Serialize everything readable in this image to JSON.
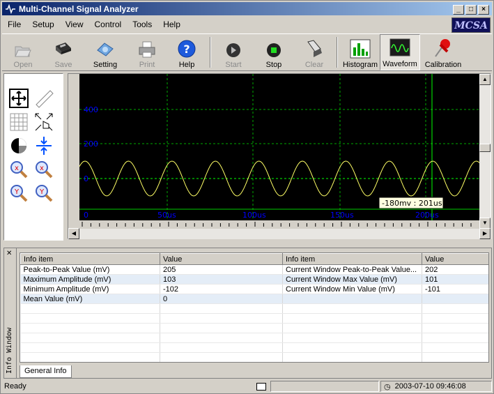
{
  "window": {
    "title": "Multi-Channel Signal Analyzer",
    "logo": "MCSA"
  },
  "menu": [
    "File",
    "Setup",
    "View",
    "Control",
    "Tools",
    "Help"
  ],
  "toolbar": {
    "open": "Open",
    "save": "Save",
    "setting": "Setting",
    "print": "Print",
    "help": "Help",
    "start": "Start",
    "stop": "Stop",
    "clear": "Clear",
    "histogram": "Histogram",
    "waveform": "Waveform",
    "calibration": "Calibration"
  },
  "scope": {
    "y_labels": [
      "400",
      "200",
      "0"
    ],
    "x_labels": [
      "0",
      "50us",
      "100us",
      "150us",
      "200us"
    ],
    "cursor_readout": "-180mv : 201us"
  },
  "info": {
    "headers": [
      "Info item",
      "Value",
      "Info item",
      "Value"
    ],
    "rows": [
      [
        "Peak-to-Peak Value (mV)",
        "205",
        "Current Window Peak-to-Peak Value...",
        "202"
      ],
      [
        "Maximum Amplitude (mV)",
        "103",
        "Current Window Max Value (mV)",
        "101"
      ],
      [
        "Minimum Amplitude (mV)",
        "-102",
        "Current Window Min Value (mV)",
        "-101"
      ],
      [
        "Mean Value (mV)",
        "0",
        "",
        ""
      ]
    ],
    "side_label": "Info Window",
    "tab": "General Info"
  },
  "status": {
    "ready": "Ready",
    "datetime": "2003-07-10 09:46:08"
  },
  "colors": {
    "titlebar": "#0a246a",
    "trace": "#ffff66",
    "grid": "#00aa00",
    "axis_label": "#0000ff",
    "cursor": "#00ff00"
  }
}
